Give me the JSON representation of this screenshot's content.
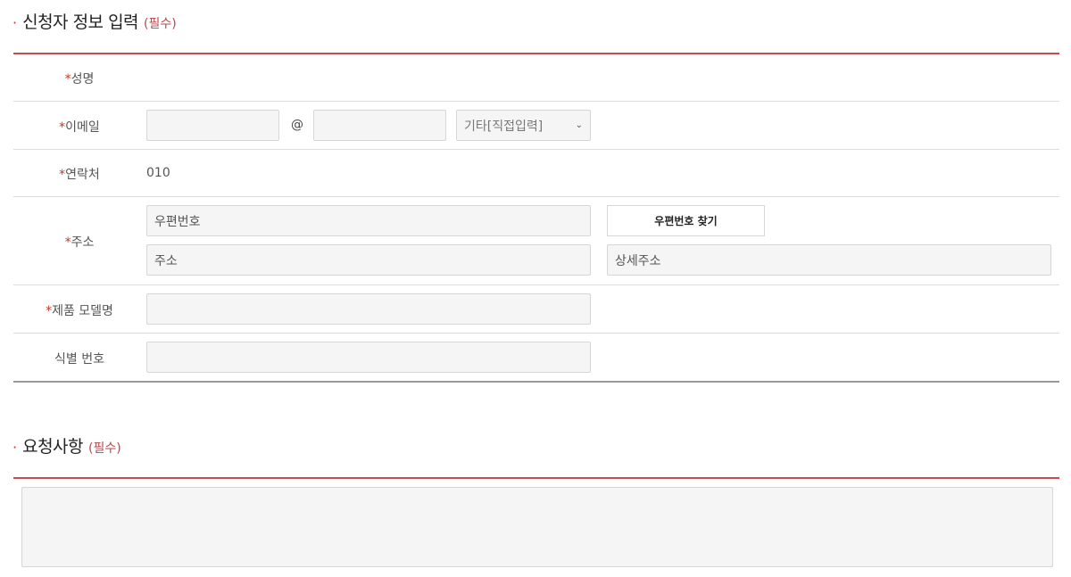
{
  "applicant": {
    "section_dot": "·",
    "title": "신청자 정보 입력",
    "required_tag": "(필수)",
    "fields": {
      "name": {
        "star": "*",
        "label": "성명"
      },
      "email": {
        "star": "*",
        "label": "이메일",
        "local_value": "",
        "at": "@",
        "domain_value": "",
        "domain_select": "기타[직접입력]"
      },
      "phone": {
        "star": "*",
        "label": "연락처",
        "value": "010"
      },
      "address": {
        "star": "*",
        "label": "주소",
        "zipcode_placeholder": "우편번호",
        "find_zip_button": "우편번호 찾기",
        "address_placeholder": "주소",
        "detail_placeholder": "상세주소"
      },
      "model": {
        "star": "*",
        "label": "제품 모델명",
        "value": ""
      },
      "serial": {
        "label": "식별 번호",
        "value": ""
      }
    }
  },
  "request": {
    "section_dot": "·",
    "title": "요청사항",
    "required_tag": "(필수)",
    "value": ""
  },
  "colors": {
    "accent": "#c84a52",
    "required": "#c0392b",
    "input_bg": "#f5f5f5"
  },
  "icons": {
    "select_arrow": "chevron-down-icon"
  }
}
